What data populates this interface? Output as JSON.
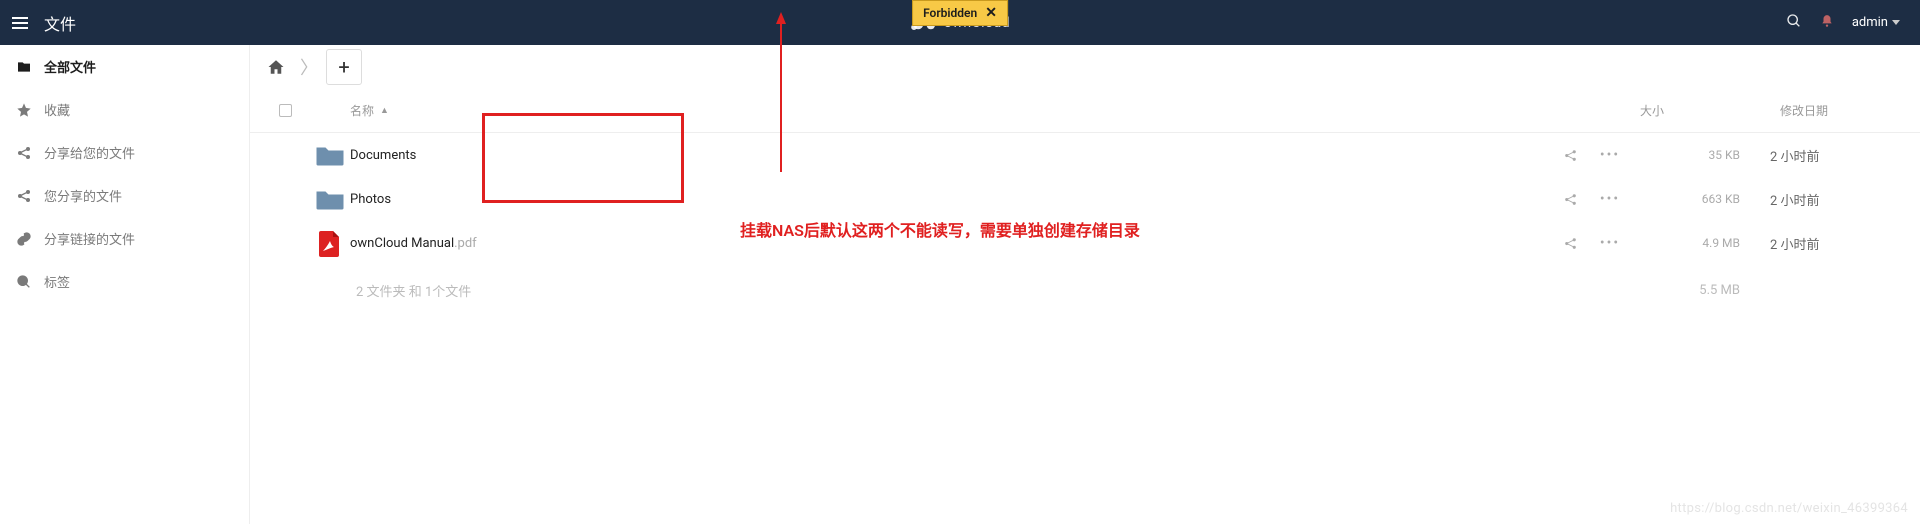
{
  "topbar": {
    "title": "文件",
    "brand": "ownCloud",
    "search_aria": "search",
    "notifications_aria": "notifications",
    "user_label": "admin"
  },
  "toast": {
    "message": "Forbidden"
  },
  "sidebar": {
    "items": [
      {
        "label": "全部文件"
      },
      {
        "label": "收藏"
      },
      {
        "label": "分享给您的文件"
      },
      {
        "label": "您分享的文件"
      },
      {
        "label": "分享链接的文件"
      },
      {
        "label": "标签"
      }
    ]
  },
  "controls": {
    "home_aria": "home",
    "add_label": "+"
  },
  "table": {
    "headers": {
      "name": "名称",
      "size": "大小",
      "modified": "修改日期"
    },
    "rows": [
      {
        "name": "Documents",
        "ext": "",
        "type": "folder",
        "size": "35 KB",
        "modified": "2 小时前"
      },
      {
        "name": "Photos",
        "ext": "",
        "type": "folder",
        "size": "663 KB",
        "modified": "2 小时前"
      },
      {
        "name": "ownCloud Manual",
        "ext": ".pdf",
        "type": "pdf",
        "size": "4.9 MB",
        "modified": "2 小时前"
      }
    ],
    "summary": {
      "text": "2 文件夹 和 1个文件",
      "total_size": "5.5 MB"
    }
  },
  "annotation": {
    "text": "挂载NAS后默认这两个不能读写，需要单独创建存储目录"
  },
  "watermark": "https://blog.csdn.net/weixin_46399364"
}
